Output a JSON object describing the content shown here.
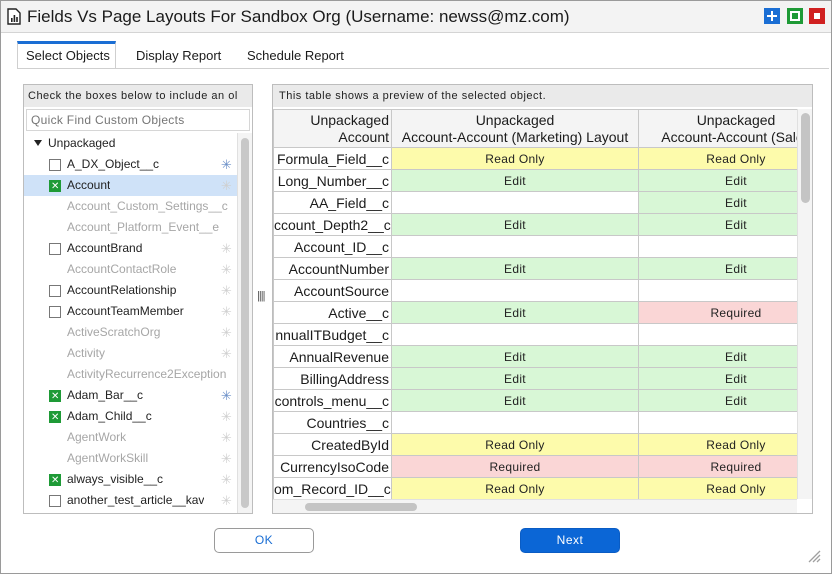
{
  "window": {
    "title": "Fields Vs Page Layouts For Sandbox Org (Username: newss@mz.com)",
    "controls": [
      "plus-icon",
      "maximize-icon",
      "close-icon"
    ]
  },
  "tabs": [
    {
      "label": "Select Objects",
      "active": true
    },
    {
      "label": "Display Report",
      "active": false
    },
    {
      "label": "Schedule Report",
      "active": false
    }
  ],
  "left_panel": {
    "hint": "Check the boxes below to include an ol",
    "search_placeholder": "Quick Find Custom Objects",
    "tree_root": "Unpackaged",
    "objects": [
      {
        "name": "A_DX_Object__c",
        "checked": false,
        "enabled": true,
        "selected": false,
        "icon": "blue"
      },
      {
        "name": "Account",
        "checked": true,
        "enabled": true,
        "selected": true,
        "icon": "gray"
      },
      {
        "name": "Account_Custom_Settings__c",
        "checked": false,
        "enabled": false,
        "selected": false,
        "icon": "none"
      },
      {
        "name": "Account_Platform_Event__e",
        "checked": false,
        "enabled": false,
        "selected": false,
        "icon": "none"
      },
      {
        "name": "AccountBrand",
        "checked": false,
        "enabled": true,
        "selected": false,
        "icon": "gray"
      },
      {
        "name": "AccountContactRole",
        "checked": false,
        "enabled": false,
        "selected": false,
        "icon": "gray"
      },
      {
        "name": "AccountRelationship",
        "checked": false,
        "enabled": true,
        "selected": false,
        "icon": "gray"
      },
      {
        "name": "AccountTeamMember",
        "checked": false,
        "enabled": true,
        "selected": false,
        "icon": "gray"
      },
      {
        "name": "ActiveScratchOrg",
        "checked": false,
        "enabled": false,
        "selected": false,
        "icon": "gray"
      },
      {
        "name": "Activity",
        "checked": false,
        "enabled": false,
        "selected": false,
        "icon": "gray"
      },
      {
        "name": "ActivityRecurrence2Exception",
        "checked": false,
        "enabled": false,
        "selected": false,
        "icon": "none"
      },
      {
        "name": "Adam_Bar__c",
        "checked": true,
        "enabled": true,
        "selected": false,
        "icon": "blue"
      },
      {
        "name": "Adam_Child__c",
        "checked": true,
        "enabled": true,
        "selected": false,
        "icon": "gray"
      },
      {
        "name": "AgentWork",
        "checked": false,
        "enabled": false,
        "selected": false,
        "icon": "gray"
      },
      {
        "name": "AgentWorkSkill",
        "checked": false,
        "enabled": false,
        "selected": false,
        "icon": "gray"
      },
      {
        "name": "always_visible__c",
        "checked": true,
        "enabled": true,
        "selected": false,
        "icon": "gray"
      },
      {
        "name": "another_test_article__kav",
        "checked": false,
        "enabled": true,
        "selected": false,
        "icon": "gray"
      }
    ]
  },
  "right_panel": {
    "hint": "This table shows a preview of the selected object.",
    "header": {
      "row_label_top": "Unpackaged",
      "row_label_bottom": "Account",
      "columns": [
        {
          "top": "Unpackaged",
          "bottom": "Account-Account (Marketing) Layout"
        },
        {
          "top": "Unpackaged",
          "bottom": "Account-Account (Sales"
        }
      ]
    },
    "rows": [
      {
        "field": "Formula_Field__c",
        "cells": [
          "Read Only",
          "Read Only"
        ]
      },
      {
        "field": "Long_Number__c",
        "cells": [
          "Edit",
          "Edit"
        ]
      },
      {
        "field": "AA_Field__c",
        "cells": [
          "",
          "Edit"
        ]
      },
      {
        "field": "ccount_Depth2__c",
        "cells": [
          "Edit",
          "Edit"
        ]
      },
      {
        "field": "Account_ID__c",
        "cells": [
          "",
          ""
        ]
      },
      {
        "field": "AccountNumber",
        "cells": [
          "Edit",
          "Edit"
        ]
      },
      {
        "field": "AccountSource",
        "cells": [
          "",
          ""
        ]
      },
      {
        "field": "Active__c",
        "cells": [
          "Edit",
          "Required"
        ]
      },
      {
        "field": "nnualITBudget__c",
        "cells": [
          "",
          ""
        ]
      },
      {
        "field": "AnnualRevenue",
        "cells": [
          "Edit",
          "Edit"
        ]
      },
      {
        "field": "BillingAddress",
        "cells": [
          "Edit",
          "Edit"
        ]
      },
      {
        "field": "controls_menu__c",
        "cells": [
          "Edit",
          "Edit"
        ]
      },
      {
        "field": "Countries__c",
        "cells": [
          "",
          ""
        ]
      },
      {
        "field": "CreatedById",
        "cells": [
          "Read Only",
          "Read Only"
        ]
      },
      {
        "field": "CurrencyIsoCode",
        "cells": [
          "Required",
          "Required"
        ]
      },
      {
        "field": "om_Record_ID__c",
        "cells": [
          "Read Only",
          "Read Only"
        ]
      }
    ]
  },
  "buttons": {
    "ok": "OK",
    "next": "Next"
  },
  "colors": {
    "accent": "#1a6ed4",
    "read_only": "#fdfbab",
    "edit": "#d8f7d6",
    "required": "#fad6d6"
  }
}
